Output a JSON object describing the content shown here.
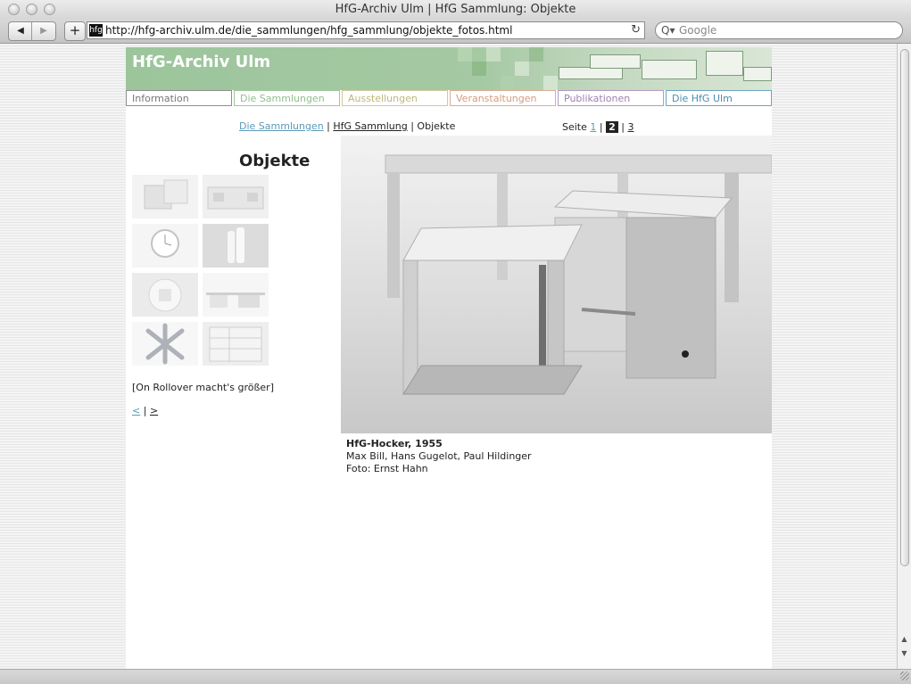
{
  "window": {
    "title": "HfG-Archiv Ulm | HfG Sammlung: Objekte"
  },
  "toolbar": {
    "back_glyph": "◀",
    "forward_glyph": "▶",
    "add_glyph": "+",
    "favicon_text": "hfg",
    "url": "http://hfg-archiv.ulm.de/die_sammlungen/hfg_sammlung/objekte_fotos.html",
    "reload_glyph": "↻",
    "search_glyph": "Q▾",
    "search_placeholder": "Google"
  },
  "site": {
    "banner_title": "HfG-Archiv Ulm",
    "nav": [
      {
        "label": "Information",
        "color": "#7a7a7a"
      },
      {
        "label": "Die Sammlungen",
        "color": "#8fbf8a"
      },
      {
        "label": "Ausstellungen",
        "color": "#c6c08a"
      },
      {
        "label": "Veranstaltungen",
        "color": "#d9a486"
      },
      {
        "label": "Publikationen",
        "color": "#a68bb8"
      },
      {
        "label": "Die HfG Ulm",
        "color": "#5b9ab8"
      }
    ]
  },
  "breadcrumb": {
    "link1": "Die Sammlungen",
    "sep1": "|",
    "link2": "HfG Sammlung",
    "sep2": "|",
    "current": "Objekte"
  },
  "pager": {
    "label": "Seite",
    "p1": "1",
    "sep1": "|",
    "p2": "2",
    "sep2": "|",
    "p3": "3"
  },
  "content": {
    "heading": "Objekte",
    "rollover_note": "[On Rollover macht's größer]",
    "prev": "<",
    "sep": "|",
    "next": ">"
  },
  "caption": {
    "title": "HfG-Hocker, 1955",
    "authors": "Max Bill, Hans Gugelot, Paul Hildinger",
    "photo": "Foto: Ernst Hahn"
  },
  "colors": {
    "link_blue": "#5b9ab8",
    "banner_green": "#9cc59c"
  }
}
